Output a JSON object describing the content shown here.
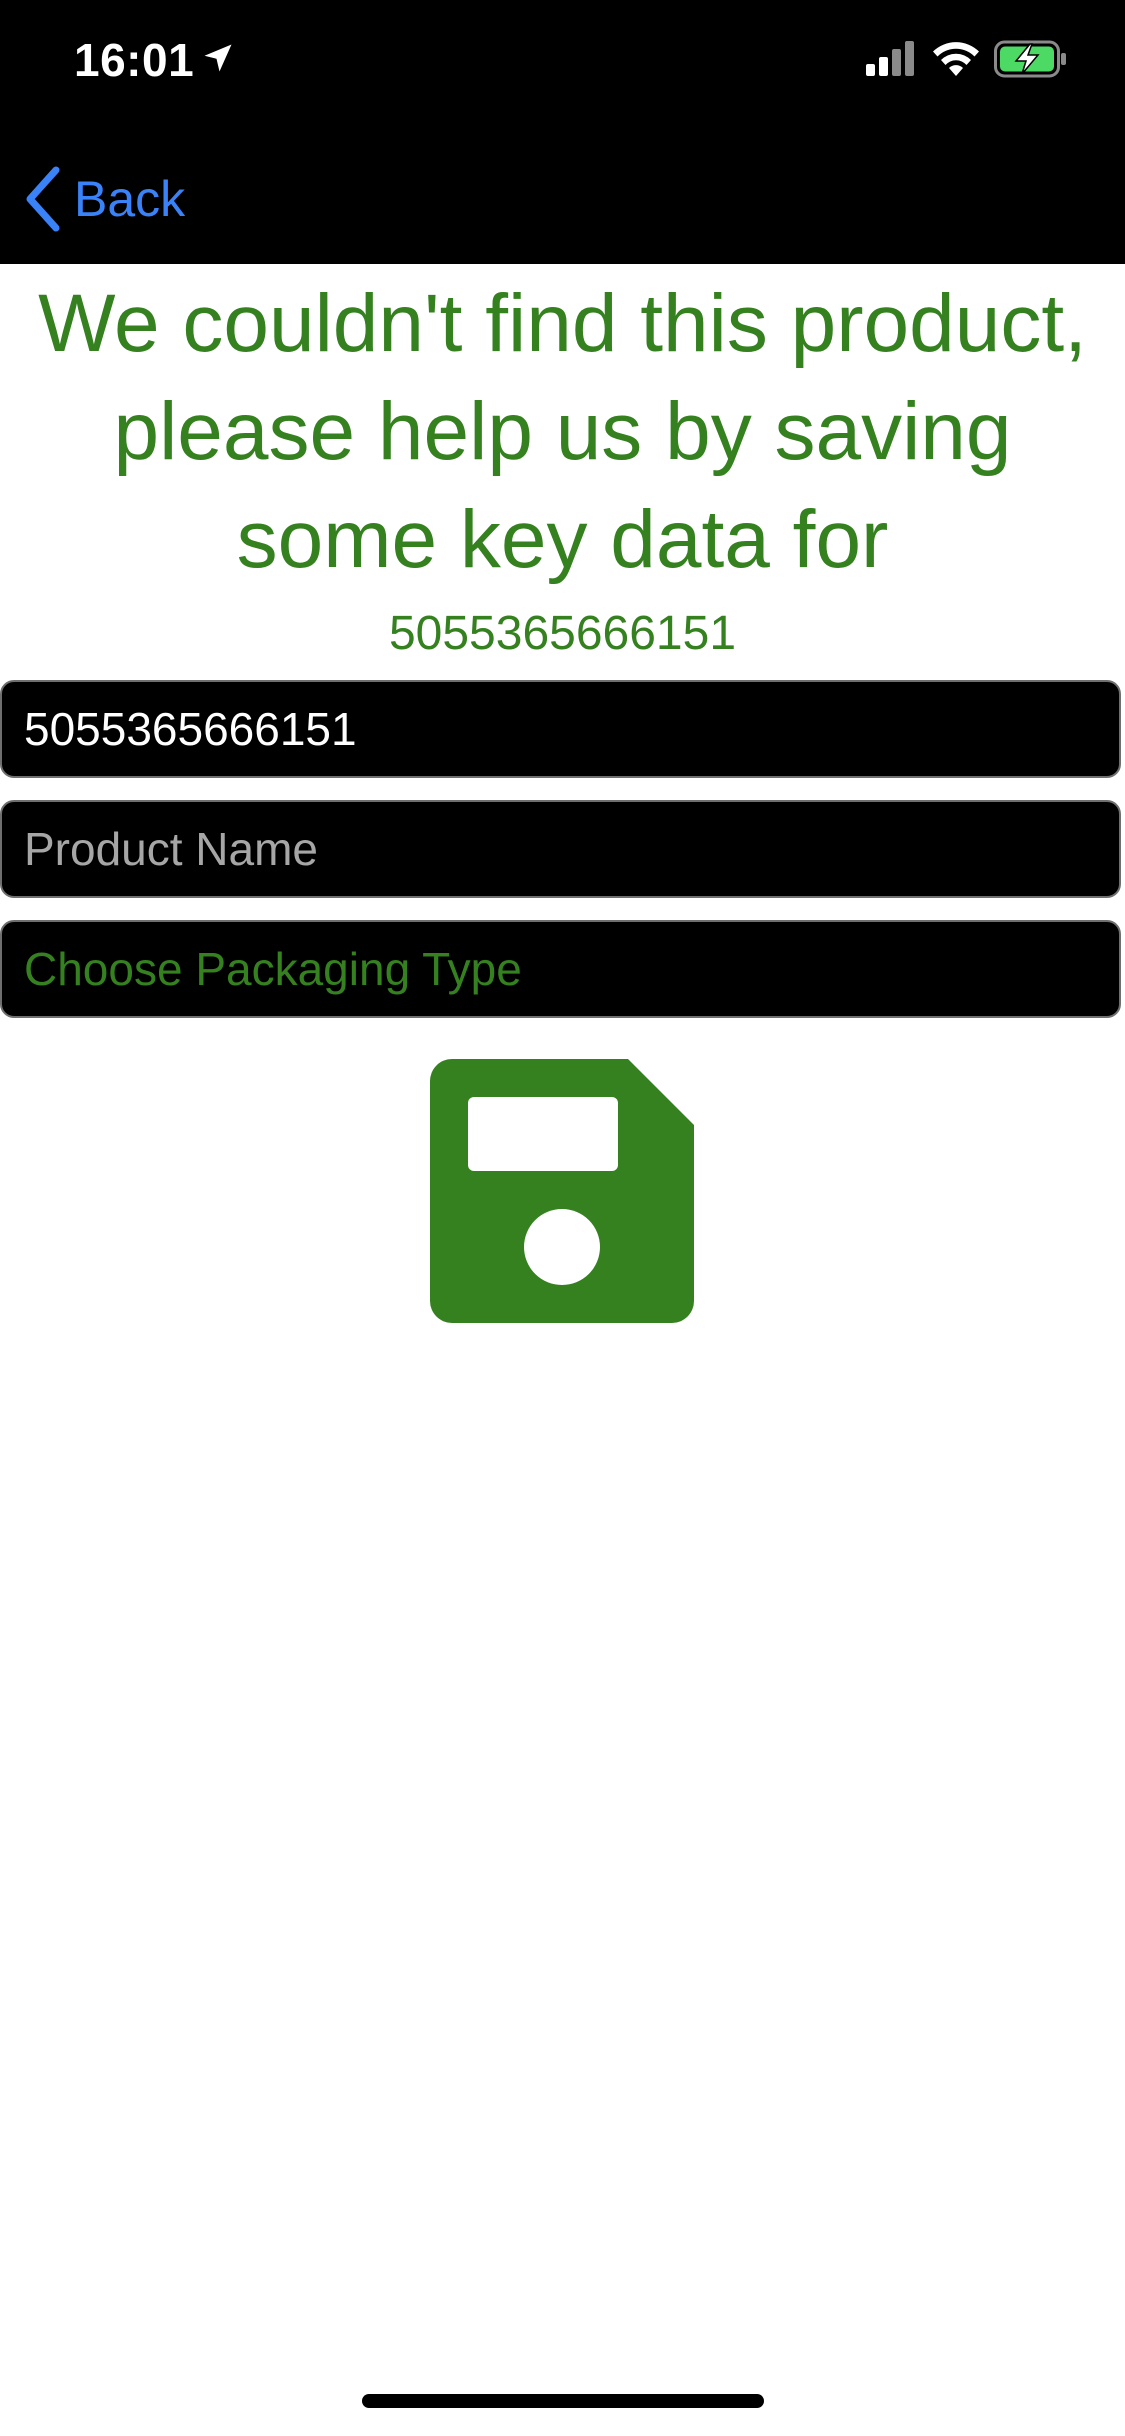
{
  "status_bar": {
    "time": "16:01",
    "icons": [
      "location-arrow-icon",
      "cellular-signal-icon",
      "wifi-icon",
      "battery-charging-icon"
    ]
  },
  "nav": {
    "back_label": "Back",
    "back_icon": "chevron-left-icon"
  },
  "heading": {
    "lines": [
      "We couldn't find this product,",
      "please help us by saving",
      "some key data for"
    ],
    "barcode": "5055365666151"
  },
  "form": {
    "barcode_value": "5055365666151",
    "product_name_placeholder": "Product Name",
    "packaging_placeholder": "Choose Packaging Type"
  },
  "save_button": {
    "icon": "floppy-disk-save-icon"
  },
  "colors": {
    "accent_green": "#35811f",
    "link_blue": "#3a82f7",
    "bar_black": "#000000",
    "battery_green": "#4cd964"
  }
}
